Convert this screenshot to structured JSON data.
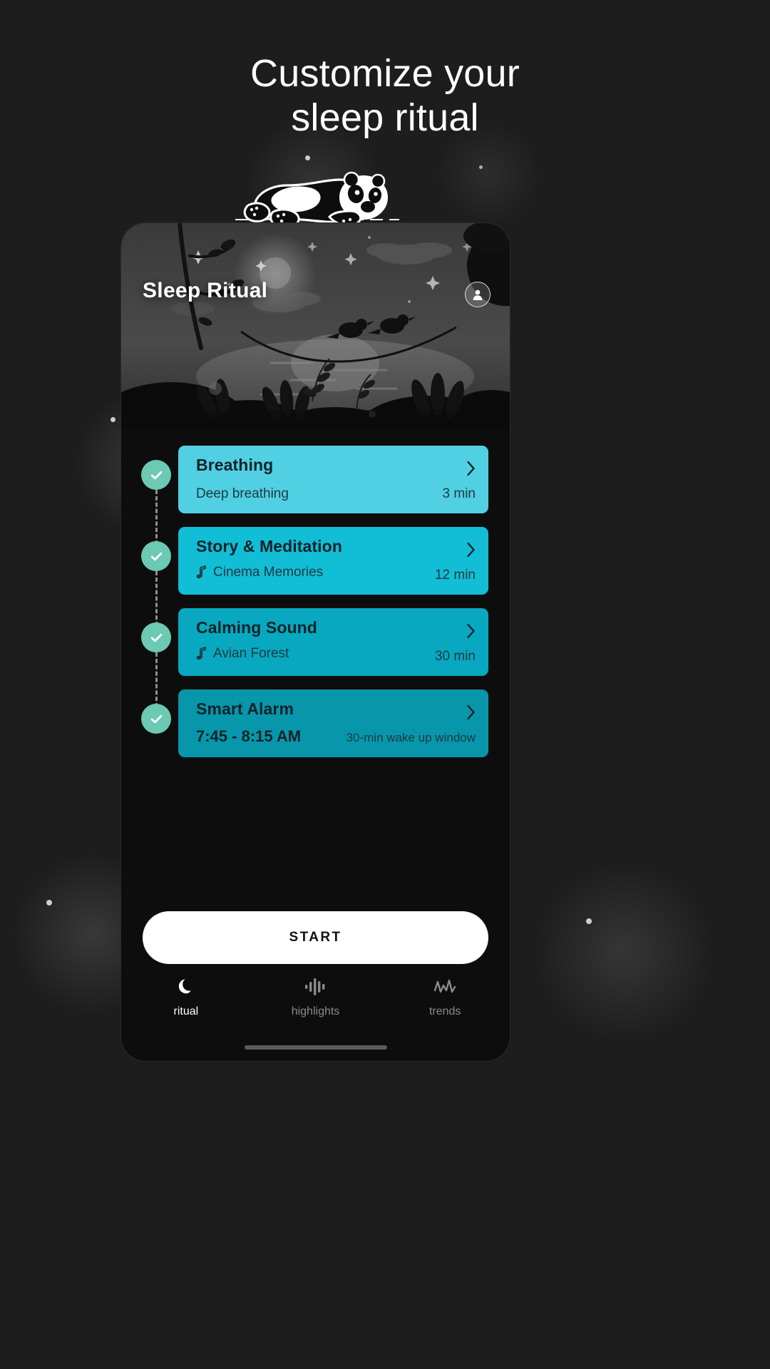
{
  "headline": {
    "line1": "Customize your",
    "line2": "sleep ritual"
  },
  "phone": {
    "header": {
      "title": "Sleep Ritual",
      "avatar_icon": "user-avatar-icon"
    },
    "ritual_steps": [
      {
        "title": "Breathing",
        "subtitle": "Deep breathing",
        "meta": "3 min",
        "has_note_icon": false,
        "color": "#51cfe3",
        "checked": true
      },
      {
        "title": "Story & Meditation",
        "subtitle": "Cinema Memories",
        "meta": "12 min",
        "has_note_icon": true,
        "color": "#12bdd6",
        "checked": true
      },
      {
        "title": "Calming Sound",
        "subtitle": "Avian Forest",
        "meta": "30 min",
        "has_note_icon": true,
        "color": "#07a8c0",
        "checked": true
      },
      {
        "title": "Smart Alarm",
        "subtitle": "7:45 - 8:15 AM",
        "meta": "30-min wake up window",
        "has_note_icon": false,
        "subtitle_strong": true,
        "color": "#0896ab",
        "checked": true
      }
    ],
    "start_button": "START",
    "nav": [
      {
        "label": "ritual",
        "icon": "moon-icon",
        "active": true
      },
      {
        "label": "highlights",
        "icon": "equalizer-icon",
        "active": false
      },
      {
        "label": "trends",
        "icon": "pulse-wave-icon",
        "active": false
      }
    ]
  },
  "colors": {
    "page_bg": "#1d1d1d",
    "phone_bg": "#0d0d0d",
    "marker": "#6bc9b4",
    "start_bg": "#ffffff",
    "accent_light": "#51cfe3",
    "accent_dark": "#0896ab"
  }
}
